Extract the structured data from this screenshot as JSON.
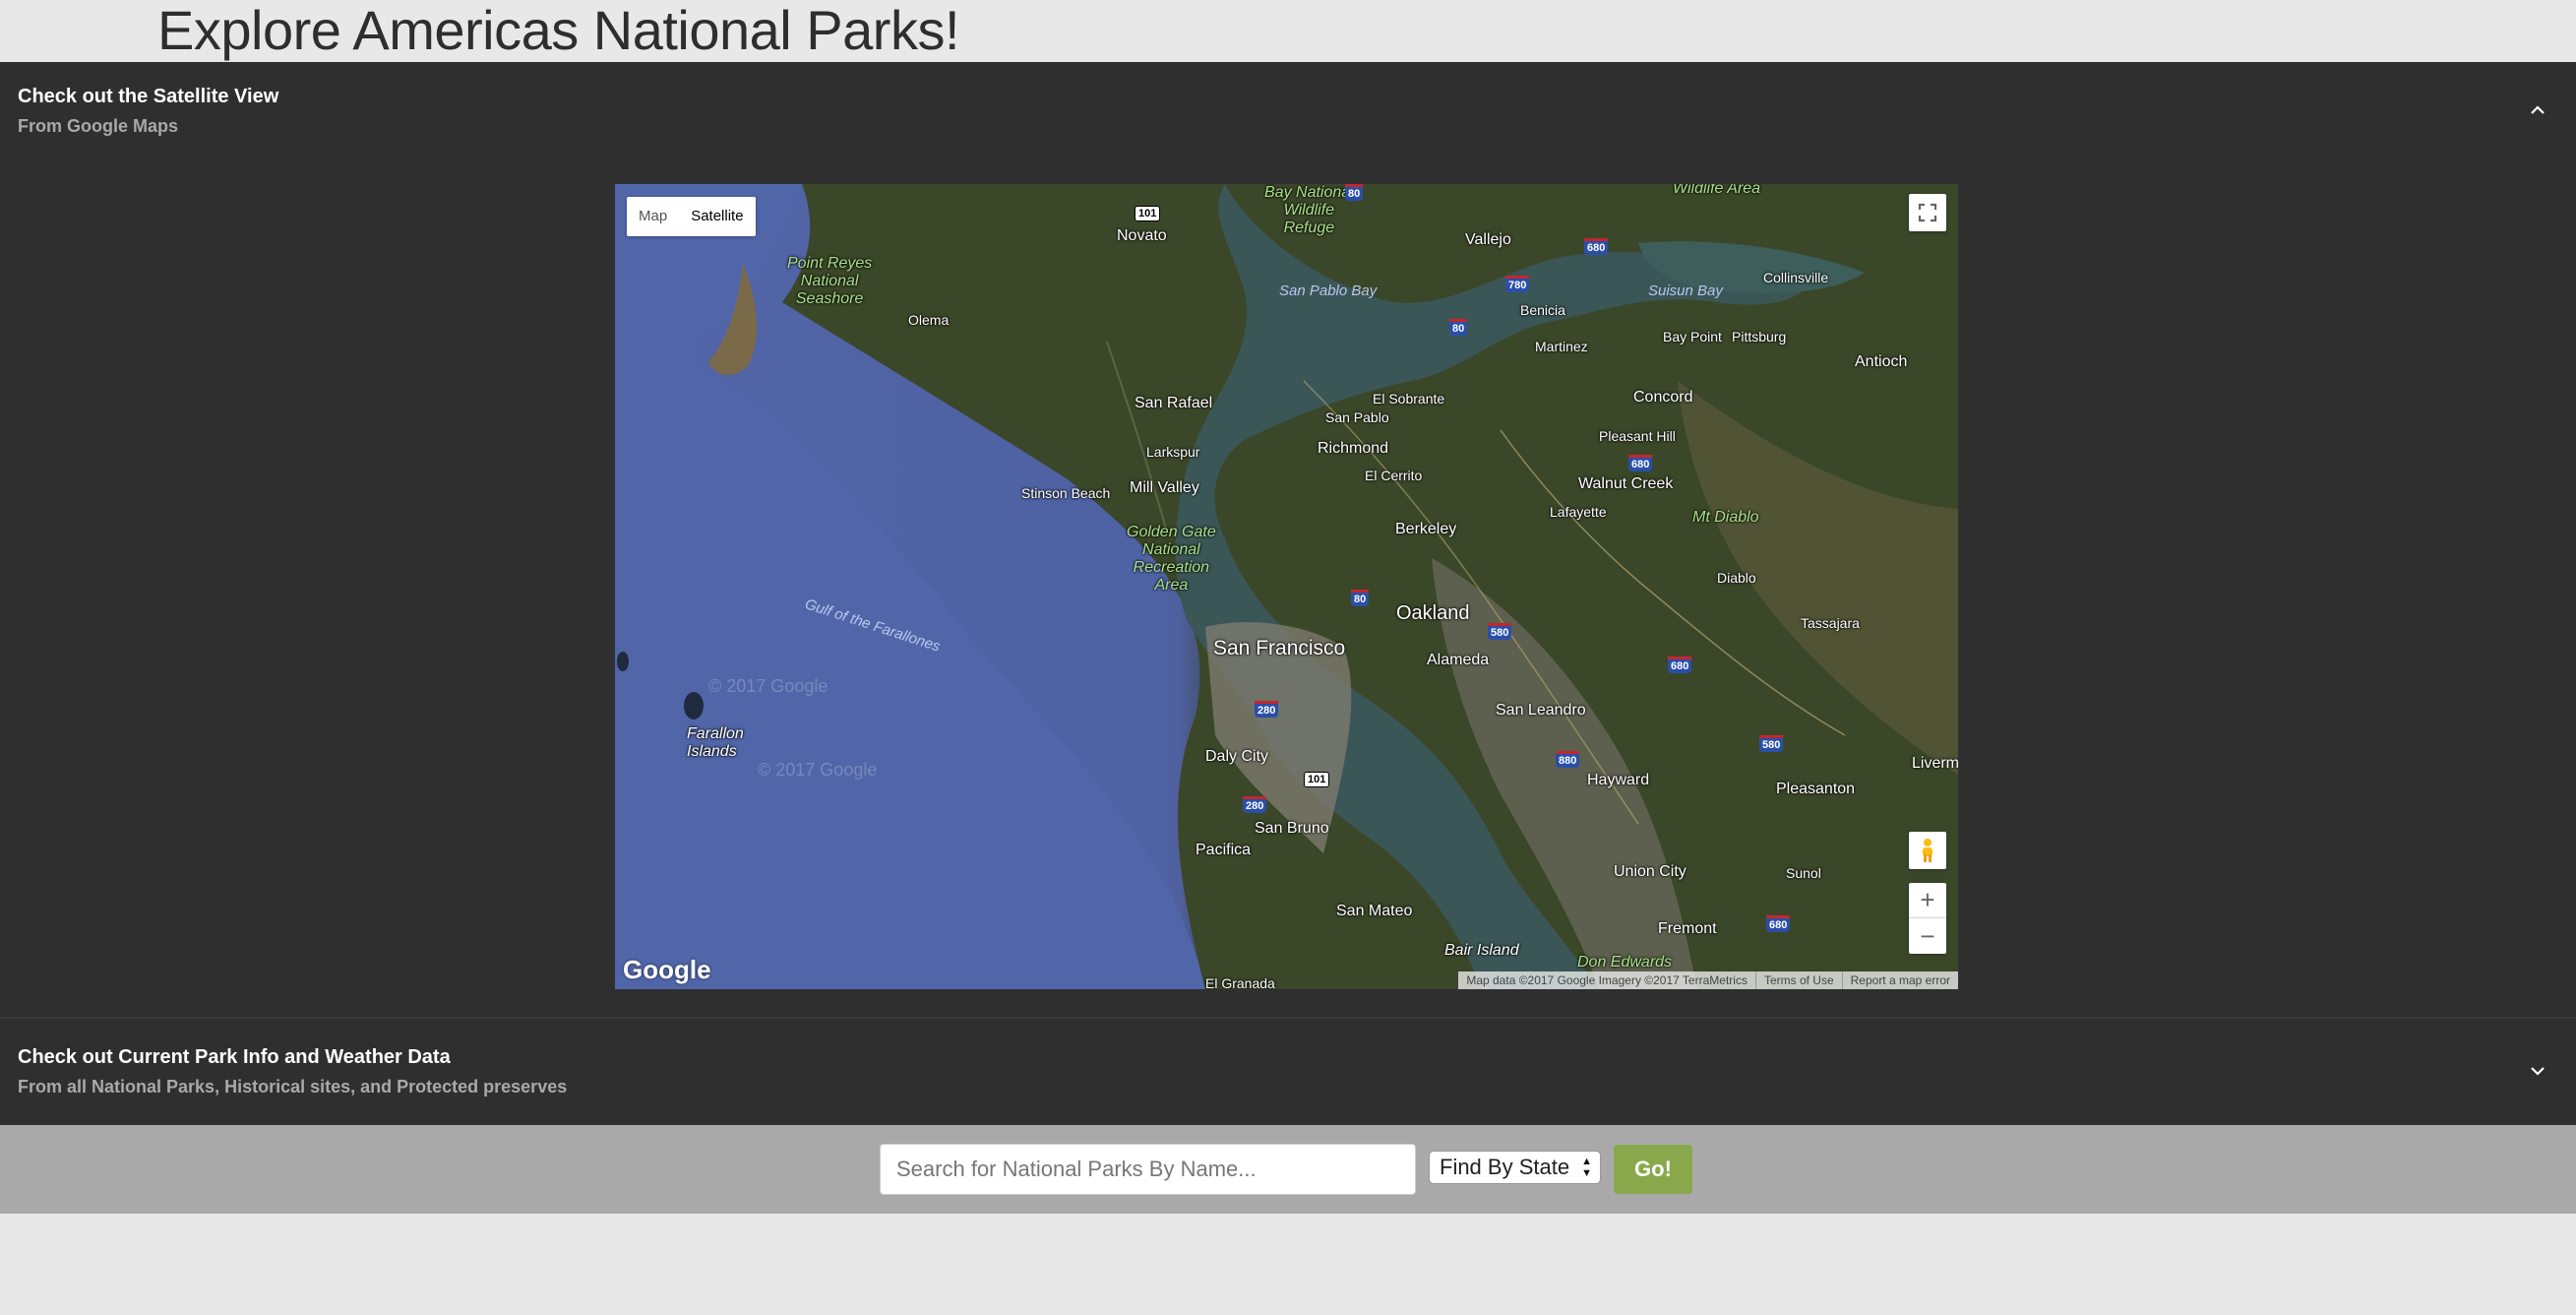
{
  "page": {
    "title": "Explore Americas National Parks!"
  },
  "satellite_section": {
    "title": "Check out the Satellite View",
    "subtitle": "From Google Maps",
    "expanded": true
  },
  "map": {
    "type_control": {
      "map_label": "Map",
      "satellite_label": "Satellite",
      "selected": "Satellite"
    },
    "zoom_in": "+",
    "zoom_out": "−",
    "logo": "Google",
    "attribution": {
      "data": "Map data ©2017 Google Imagery ©2017 TerraMetrics",
      "terms": "Terms of Use",
      "report": "Report a map error"
    },
    "watermark": "© 2017 Google",
    "places": {
      "point_reyes": "Point Reyes\nNational\nSeashore",
      "novato": "Novato",
      "bay_wildlife": "Bay National\nWildlife\nRefuge",
      "vallejo": "Vallejo",
      "wildlife_area": "Wildlife Area",
      "collinsville": "Collinsville",
      "san_pablo_bay": "San Pablo Bay",
      "suisun_bay": "Suisun Bay",
      "benicia": "Benicia",
      "olema": "Olema",
      "martinez": "Martinez",
      "bay_point": "Bay Point",
      "pittsburg": "Pittsburg",
      "antioch": "Antioch",
      "el_sobrante": "El Sobrante",
      "san_rafael": "San Rafael",
      "concord": "Concord",
      "san_pablo": "San Pablo",
      "larkspur": "Larkspur",
      "richmond": "Richmond",
      "pleasant_hill": "Pleasant Hill",
      "el_cerrito": "El Cerrito",
      "stinson_beach": "Stinson Beach",
      "mill_valley": "Mill Valley",
      "walnut_creek": "Walnut Creek",
      "lafayette": "Lafayette",
      "mt_diablo": "Mt Diablo",
      "golden_gate": "Golden Gate\nNational\nRecreation\nArea",
      "berkeley": "Berkeley",
      "diablo": "Diablo",
      "oakland": "Oakland",
      "tassajara": "Tassajara",
      "gulf": "Gulf of the Farallones",
      "san_francisco": "San Francisco",
      "alameda": "Alameda",
      "san_leandro": "San Leandro",
      "farallon": "Farallon\nIslands",
      "daly_city": "Daly City",
      "hayward": "Hayward",
      "livermore": "Livermore",
      "pleasanton": "Pleasanton",
      "pacifica": "Pacifica",
      "san_bruno": "San Bruno",
      "sunol": "Sunol",
      "union_city": "Union City",
      "san_mateo": "San Mateo",
      "fremont": "Fremont",
      "bair_island": "Bair Island",
      "don_edwards": "Don Edwards",
      "el_granada": "El Granada"
    },
    "shields": {
      "s101a": "101",
      "s80a": "80",
      "s780": "780",
      "s680a": "680",
      "s80b": "80",
      "s680b": "680",
      "s80c": "80",
      "s580a": "580",
      "s680c": "680",
      "s280a": "280",
      "s880a": "880",
      "s101b": "101",
      "s580b": "580",
      "s280b": "280",
      "s680d": "680"
    }
  },
  "info_section": {
    "title": "Check out Current Park Info and Weather Data",
    "subtitle": "From all National Parks, Historical sites, and Protected preserves",
    "expanded": false
  },
  "search": {
    "placeholder": "Search for National Parks By Name...",
    "state_select": "Find By State",
    "go_label": "Go!"
  },
  "colors": {
    "accent_green": "#88a84b",
    "panel_dark": "#2f2f2f",
    "bar_gray": "#a9a9a9"
  }
}
